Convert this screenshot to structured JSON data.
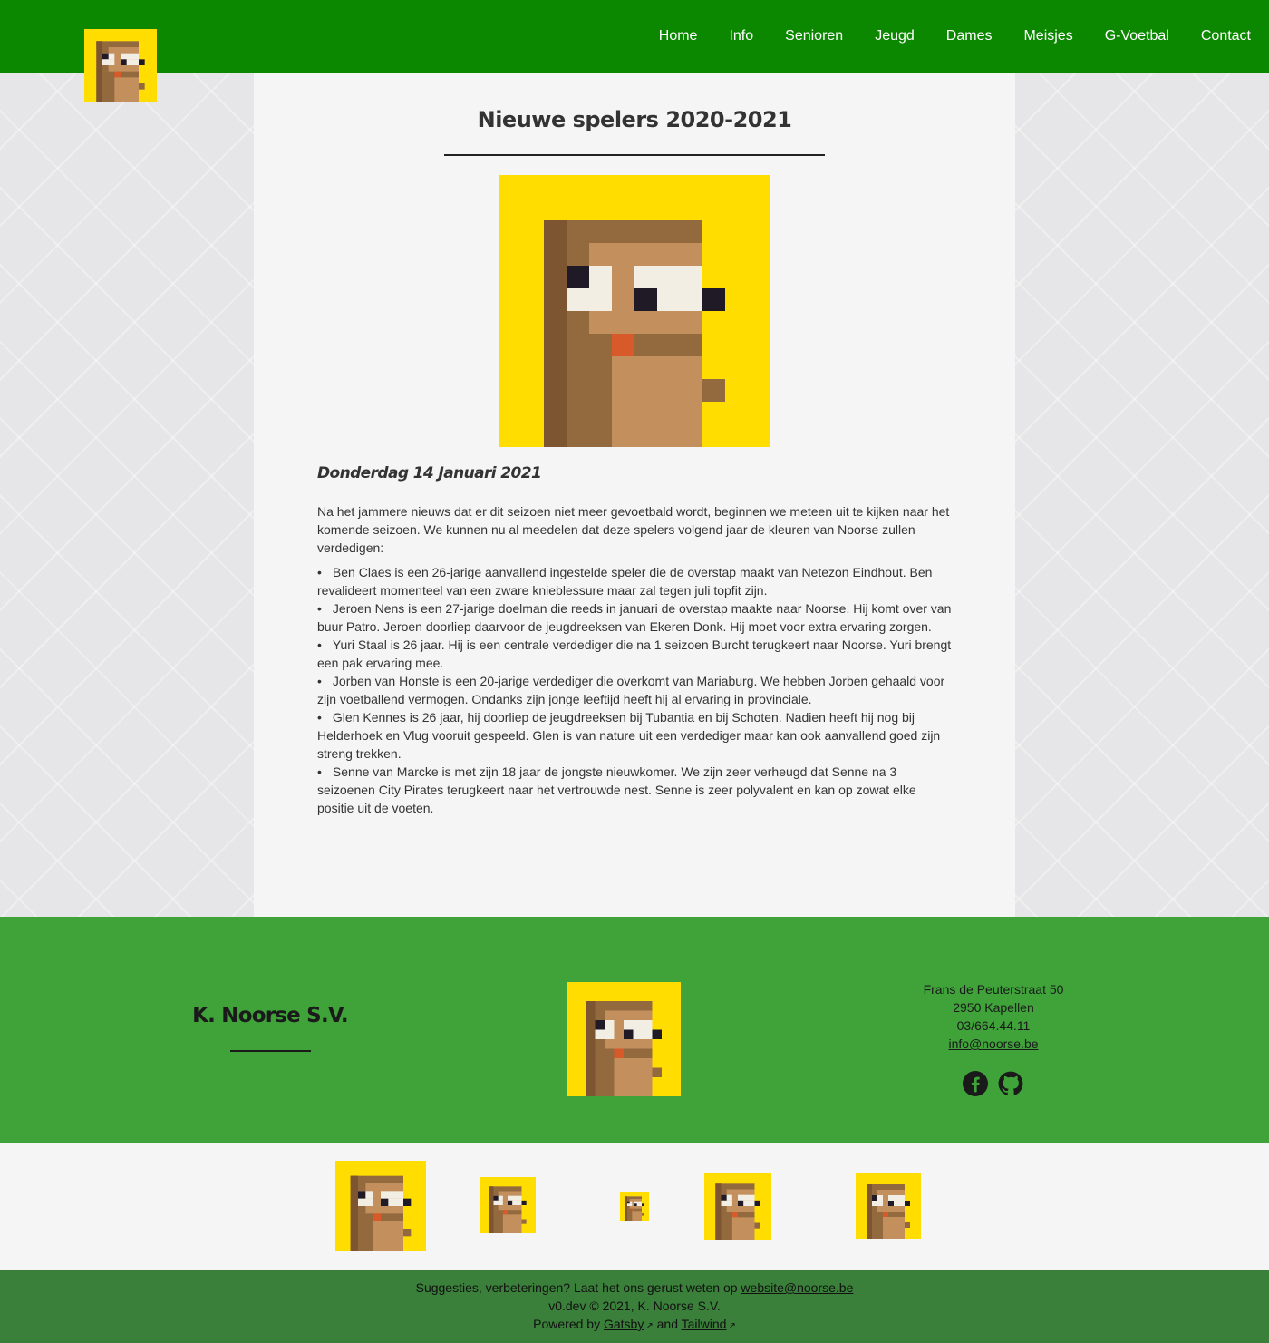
{
  "colors": {
    "header_bg": "#0b8800",
    "footer_bg": "#3fa33a",
    "bottom_bg": "#3a7f3a",
    "logo_bg": "#ffdd00"
  },
  "header": {
    "logo_icon": "bear-logo-icon",
    "nav": [
      "Home",
      "Info",
      "Senioren",
      "Jeugd",
      "Dames",
      "Meisjes",
      "G-Voetbal",
      "Contact"
    ]
  },
  "article": {
    "title": "Nieuwe spelers 2020-2021",
    "date": "Donderdag 14 Januari 2021",
    "intro": "Na het jammere nieuws dat er dit seizoen niet meer gevoetbald wordt, beginnen we meteen uit te kijken naar het komende seizoen. We kunnen nu al meedelen dat deze spelers volgend jaar de kleuren van Noorse zullen verdedigen:",
    "players": [
      "Ben Claes is een 26-jarige aanvallend ingestelde speler die de overstap maakt van Netezon Eindhout. Ben revalideert momenteel van een zware knieblessure maar zal tegen juli topfit zijn.",
      "Jeroen Nens is een 27-jarige doelman die reeds in januari de overstap maakte naar Noorse. Hij komt over van buur Patro. Jeroen doorliep daarvoor de jeugdreeksen van Ekeren Donk. Hij moet voor extra ervaring zorgen.",
      "Yuri Staal is 26 jaar. Hij is een centrale verdediger die na 1 seizoen Burcht terugkeert naar Noorse. Yuri brengt een pak ervaring mee.",
      "Jorben van Honste is een 20-jarige verdediger die overkomt van Mariaburg. We hebben Jorben gehaald voor zijn voetballend vermogen. Ondanks zijn jonge leeftijd heeft hij al ervaring in provinciale.",
      "Glen Kennes is 26 jaar, hij doorliep de jeugdreeksen bij Tubantia en bij Schoten. Nadien heeft hij nog bij Helderhoek en Vlug vooruit gespeeld. Glen is van nature uit een verdediger maar kan ook aanvallend goed zijn streng trekken.",
      "Senne van Marcke is met zijn 18 jaar de jongste nieuwkomer. We zijn zeer verheugd dat Senne na 3 seizoenen City Pirates terugkeert naar het vertrouwde nest. Senne is zeer polyvalent en kan op zowat elke positie uit de voeten."
    ]
  },
  "footer": {
    "club_name": "K. Noorse S.V.",
    "street": "Frans de Peuterstraat 50",
    "city": "2950 Kapellen",
    "phone": "03/664.44.11",
    "email": "info@noorse.be",
    "social_icons": [
      "facebook-icon",
      "github-icon"
    ]
  },
  "bottom": {
    "suggest_text": "Suggesties, verbeteringen? Laat het ons gerust weten op ",
    "suggest_email": "website@noorse.be",
    "copyright": "v0.dev © 2021, K. Noorse S.V.",
    "powered_by": "Powered by ",
    "gatsby": "Gatsby",
    "and": " and ",
    "tailwind": "Tailwind"
  }
}
